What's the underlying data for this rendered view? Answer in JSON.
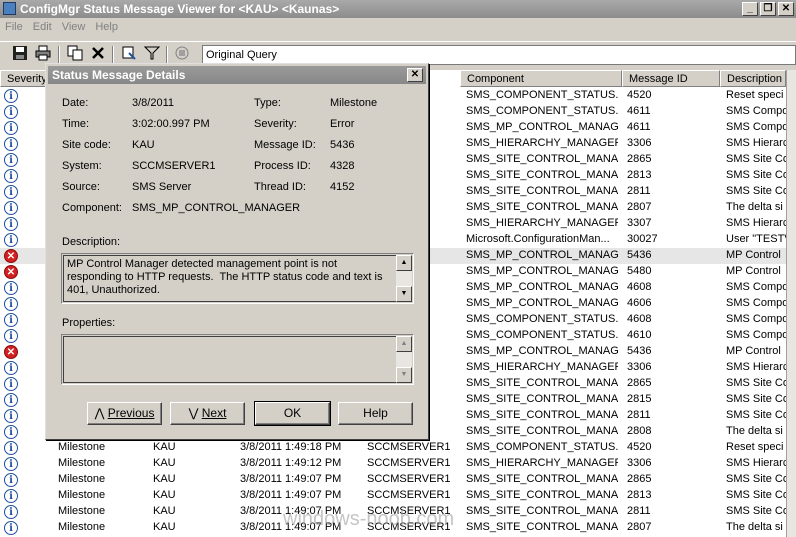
{
  "window": {
    "title": "ConfigMgr Status Message Viewer for <KAU> <Kaunas>",
    "minimize": "_",
    "restore": "❐",
    "close": "✕"
  },
  "menu": [
    "File",
    "Edit",
    "View",
    "Help"
  ],
  "toolbar": {
    "query": "Original Query"
  },
  "columns": [
    "Severity",
    "Component",
    "Message ID",
    "Description"
  ],
  "rows": [
    {
      "sev": "info",
      "type": "",
      "site": "",
      "date": "",
      "sys": "1",
      "comp": "SMS_COMPONENT_STATUS...",
      "id": "4520",
      "desc": "Reset speci"
    },
    {
      "sev": "info",
      "type": "",
      "site": "",
      "date": "",
      "sys": "1",
      "comp": "SMS_COMPONENT_STATUS...",
      "id": "4611",
      "desc": "SMS Compo"
    },
    {
      "sev": "info",
      "type": "",
      "site": "",
      "date": "",
      "sys": "1",
      "comp": "SMS_MP_CONTROL_MANAGER",
      "id": "4611",
      "desc": "SMS Compo"
    },
    {
      "sev": "info",
      "type": "",
      "site": "",
      "date": "",
      "sys": "1",
      "comp": "SMS_HIERARCHY_MANAGER",
      "id": "3306",
      "desc": "SMS Hierarc"
    },
    {
      "sev": "info",
      "type": "",
      "site": "",
      "date": "",
      "sys": "1",
      "comp": "SMS_SITE_CONTROL_MANA...",
      "id": "2865",
      "desc": "SMS Site Co"
    },
    {
      "sev": "info",
      "type": "",
      "site": "",
      "date": "",
      "sys": "1",
      "comp": "SMS_SITE_CONTROL_MANA...",
      "id": "2813",
      "desc": "SMS Site Co"
    },
    {
      "sev": "info",
      "type": "",
      "site": "",
      "date": "",
      "sys": "1",
      "comp": "SMS_SITE_CONTROL_MANA...",
      "id": "2811",
      "desc": "SMS Site Co"
    },
    {
      "sev": "info",
      "type": "",
      "site": "",
      "date": "",
      "sys": "1",
      "comp": "SMS_SITE_CONTROL_MANA...",
      "id": "2807",
      "desc": "The delta si"
    },
    {
      "sev": "info",
      "type": "",
      "site": "",
      "date": "",
      "sys": "1",
      "comp": "SMS_HIERARCHY_MANAGER",
      "id": "3307",
      "desc": "SMS Hierarc"
    },
    {
      "sev": "info",
      "type": "",
      "site": "",
      "date": "",
      "sys": "1",
      "comp": "Microsoft.ConfigurationMan...",
      "id": "30027",
      "desc": "User \"TESTV"
    },
    {
      "sev": "err",
      "type": "",
      "site": "",
      "date": "",
      "sys": "1",
      "comp": "SMS_MP_CONTROL_MANAGER",
      "id": "5436",
      "desc": "MP Control",
      "sel": true
    },
    {
      "sev": "err",
      "type": "",
      "site": "",
      "date": "",
      "sys": "1",
      "comp": "SMS_MP_CONTROL_MANAGER",
      "id": "5480",
      "desc": "MP Control"
    },
    {
      "sev": "info",
      "type": "",
      "site": "",
      "date": "",
      "sys": "1",
      "comp": "SMS_MP_CONTROL_MANAGER",
      "id": "4608",
      "desc": "SMS Compo"
    },
    {
      "sev": "info",
      "type": "",
      "site": "",
      "date": "",
      "sys": "1",
      "comp": "SMS_MP_CONTROL_MANAGER",
      "id": "4606",
      "desc": "SMS Compo"
    },
    {
      "sev": "info",
      "type": "",
      "site": "",
      "date": "",
      "sys": "1",
      "comp": "SMS_COMPONENT_STATUS...",
      "id": "4608",
      "desc": "SMS Compo"
    },
    {
      "sev": "info",
      "type": "",
      "site": "",
      "date": "",
      "sys": "1",
      "comp": "SMS_COMPONENT_STATUS...",
      "id": "4610",
      "desc": "SMS Compo"
    },
    {
      "sev": "err",
      "type": "",
      "site": "",
      "date": "",
      "sys": "1",
      "comp": "SMS_MP_CONTROL_MANAGER",
      "id": "5436",
      "desc": "MP Control"
    },
    {
      "sev": "info",
      "type": "",
      "site": "",
      "date": "",
      "sys": "1",
      "comp": "SMS_HIERARCHY_MANAGER",
      "id": "3306",
      "desc": "SMS Hierarc"
    },
    {
      "sev": "info",
      "type": "",
      "site": "",
      "date": "",
      "sys": "1",
      "comp": "SMS_SITE_CONTROL_MANA...",
      "id": "2865",
      "desc": "SMS Site Co"
    },
    {
      "sev": "info",
      "type": "",
      "site": "",
      "date": "",
      "sys": "1",
      "comp": "SMS_SITE_CONTROL_MANA...",
      "id": "2815",
      "desc": "SMS Site Co"
    },
    {
      "sev": "info",
      "type": "",
      "site": "",
      "date": "",
      "sys": "1",
      "comp": "SMS_SITE_CONTROL_MANA...",
      "id": "2811",
      "desc": "SMS Site Co"
    },
    {
      "sev": "info",
      "type": "",
      "site": "",
      "date": "",
      "sys": "1",
      "comp": "SMS_SITE_CONTROL_MANA...",
      "id": "2808",
      "desc": "The delta si"
    },
    {
      "sev": "info",
      "type": "Milestone",
      "site": "KAU",
      "date": "3/8/2011 1:49:18 PM",
      "sys": "SCCMSERVER1",
      "comp": "SMS_COMPONENT_STATUS...",
      "id": "4520",
      "desc": "Reset speci"
    },
    {
      "sev": "info",
      "type": "Milestone",
      "site": "KAU",
      "date": "3/8/2011 1:49:12 PM",
      "sys": "SCCMSERVER1",
      "comp": "SMS_HIERARCHY_MANAGER",
      "id": "3306",
      "desc": "SMS Hierarc"
    },
    {
      "sev": "info",
      "type": "Milestone",
      "site": "KAU",
      "date": "3/8/2011 1:49:07 PM",
      "sys": "SCCMSERVER1",
      "comp": "SMS_SITE_CONTROL_MANA...",
      "id": "2865",
      "desc": "SMS Site Co"
    },
    {
      "sev": "info",
      "type": "Milestone",
      "site": "KAU",
      "date": "3/8/2011 1:49:07 PM",
      "sys": "SCCMSERVER1",
      "comp": "SMS_SITE_CONTROL_MANA...",
      "id": "2813",
      "desc": "SMS Site Co"
    },
    {
      "sev": "info",
      "type": "Milestone",
      "site": "KAU",
      "date": "3/8/2011 1:49:07 PM",
      "sys": "SCCMSERVER1",
      "comp": "SMS_SITE_CONTROL_MANA...",
      "id": "2811",
      "desc": "SMS Site Co"
    },
    {
      "sev": "info",
      "type": "Milestone",
      "site": "KAU",
      "date": "3/8/2011 1:49:07 PM",
      "sys": "SCCMSERVER1",
      "comp": "SMS_SITE_CONTROL_MANA...",
      "id": "2807",
      "desc": "The delta si"
    }
  ],
  "dialog": {
    "title": "Status Message Details",
    "date_label": "Date:",
    "date": "3/8/2011",
    "time_label": "Time:",
    "time": "3:02:00.997 PM",
    "site_label": "Site code:",
    "site": "KAU",
    "system_label": "System:",
    "system": "SCCMSERVER1",
    "source_label": "Source:",
    "source": "SMS Server",
    "component_label": "Component:",
    "component": "SMS_MP_CONTROL_MANAGER",
    "type_label": "Type:",
    "type": "Milestone",
    "severity_label": "Severity:",
    "severity": "Error",
    "msgid_label": "Message ID:",
    "msgid": "5436",
    "process_label": "Process ID:",
    "process": "4328",
    "thread_label": "Thread ID:",
    "thread": "4152",
    "description_label": "Description:",
    "description": "MP Control Manager detected management point is not responding to HTTP requests.  The HTTP status code and text is 401, Unauthorized.",
    "properties_label": "Properties:",
    "prev_arrow": "⋀",
    "prev": "Previous",
    "next_arrow": "⋁",
    "next": "Next",
    "ok": "OK",
    "help": "Help"
  },
  "watermark": "windows-noob.com"
}
